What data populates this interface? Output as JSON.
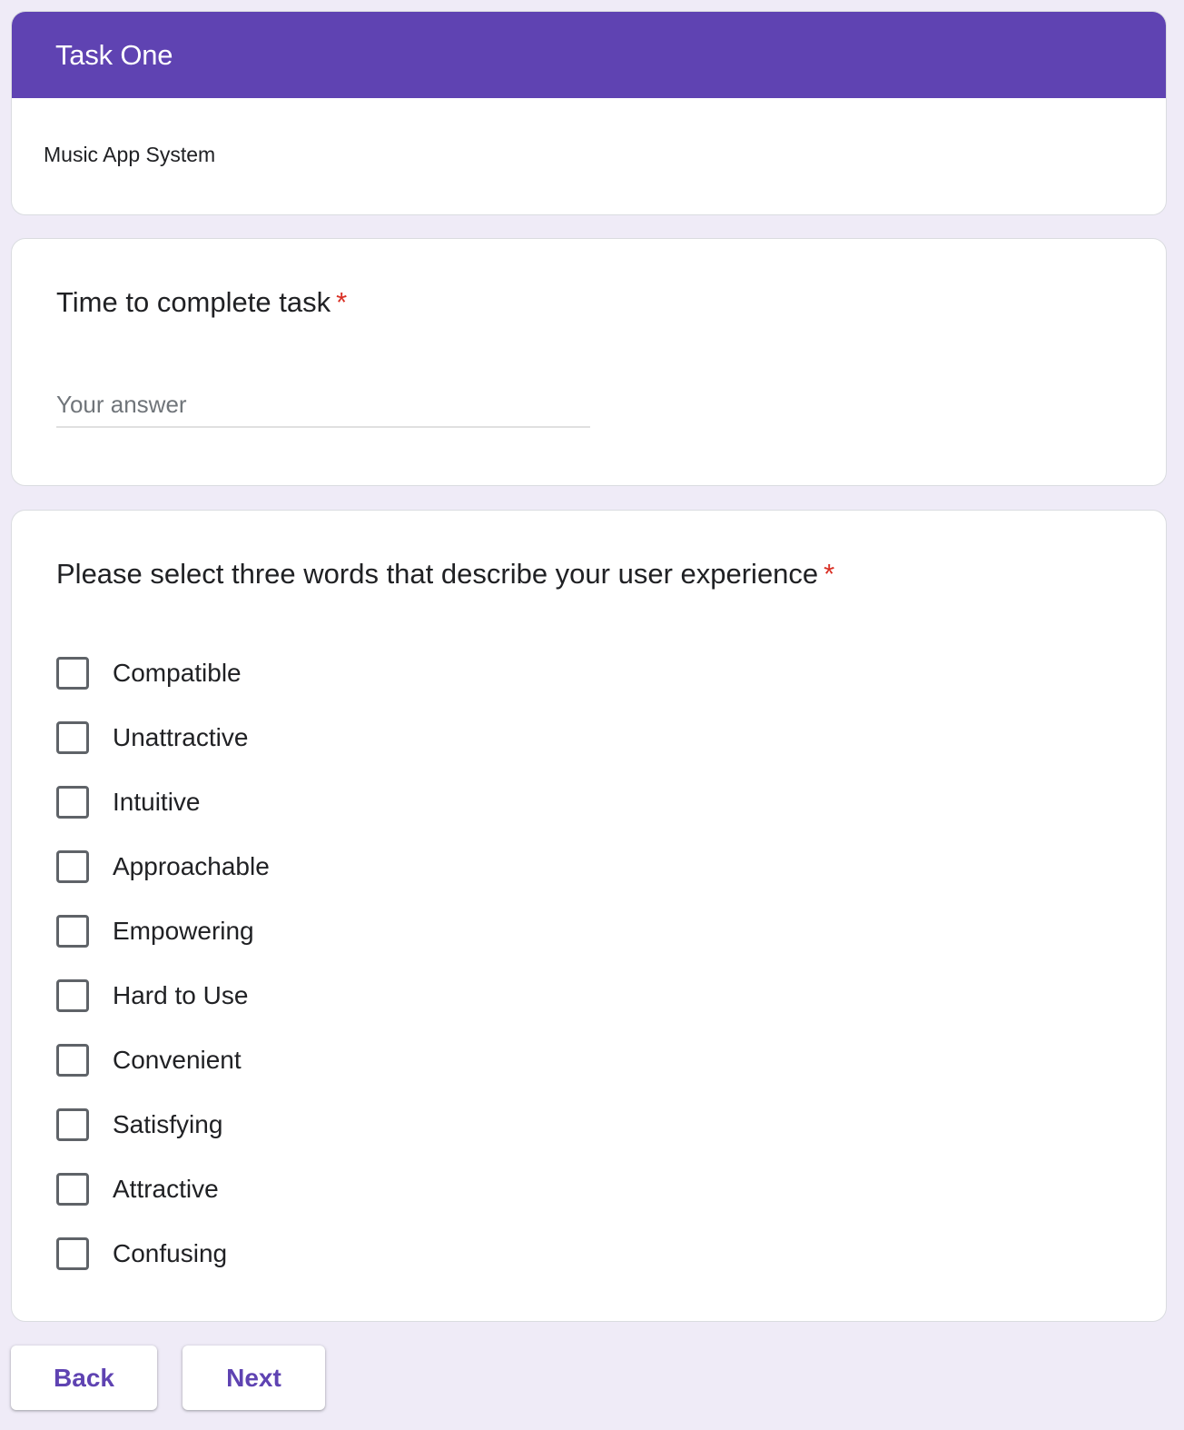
{
  "section": {
    "title": "Task One",
    "description": "Music App System"
  },
  "question1": {
    "title": "Time to complete task",
    "required_marker": "*",
    "placeholder": "Your answer",
    "value": ""
  },
  "question2": {
    "title": "Please select three words that describe your user experience",
    "required_marker": "*",
    "options": [
      {
        "label": "Compatible",
        "checked": false
      },
      {
        "label": "Unattractive",
        "checked": false
      },
      {
        "label": "Intuitive",
        "checked": false
      },
      {
        "label": "Approachable",
        "checked": false
      },
      {
        "label": "Empowering",
        "checked": false
      },
      {
        "label": "Hard to Use",
        "checked": false
      },
      {
        "label": "Convenient",
        "checked": false
      },
      {
        "label": "Satisfying",
        "checked": false
      },
      {
        "label": "Attractive",
        "checked": false
      },
      {
        "label": "Confusing",
        "checked": false
      }
    ]
  },
  "navigation": {
    "back_label": "Back",
    "next_label": "Next"
  },
  "colors": {
    "accent": "#5f43b2",
    "page_background": "#efebf7",
    "required": "#d93025"
  }
}
